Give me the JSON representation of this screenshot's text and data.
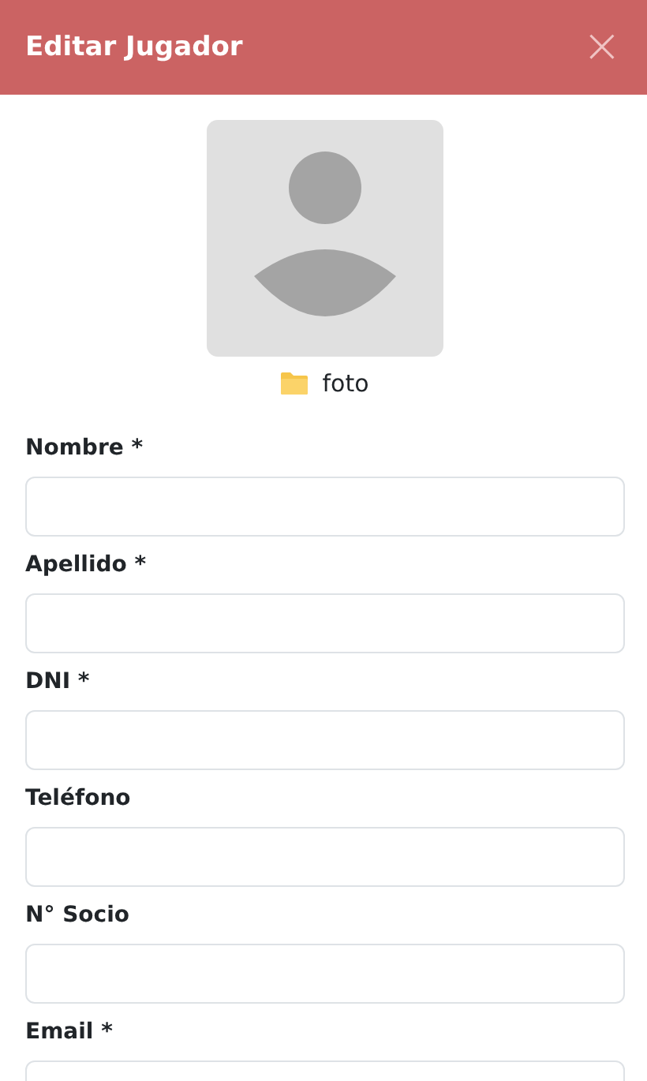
{
  "header": {
    "title": "Editar Jugador",
    "close": "×"
  },
  "photo": {
    "label": "foto"
  },
  "fields": [
    {
      "label": "Nombre *"
    },
    {
      "label": "Apellido *"
    },
    {
      "label": "DNI *"
    },
    {
      "label": "Teléfono"
    },
    {
      "label": "N° Socio"
    },
    {
      "label": "Email *"
    }
  ]
}
